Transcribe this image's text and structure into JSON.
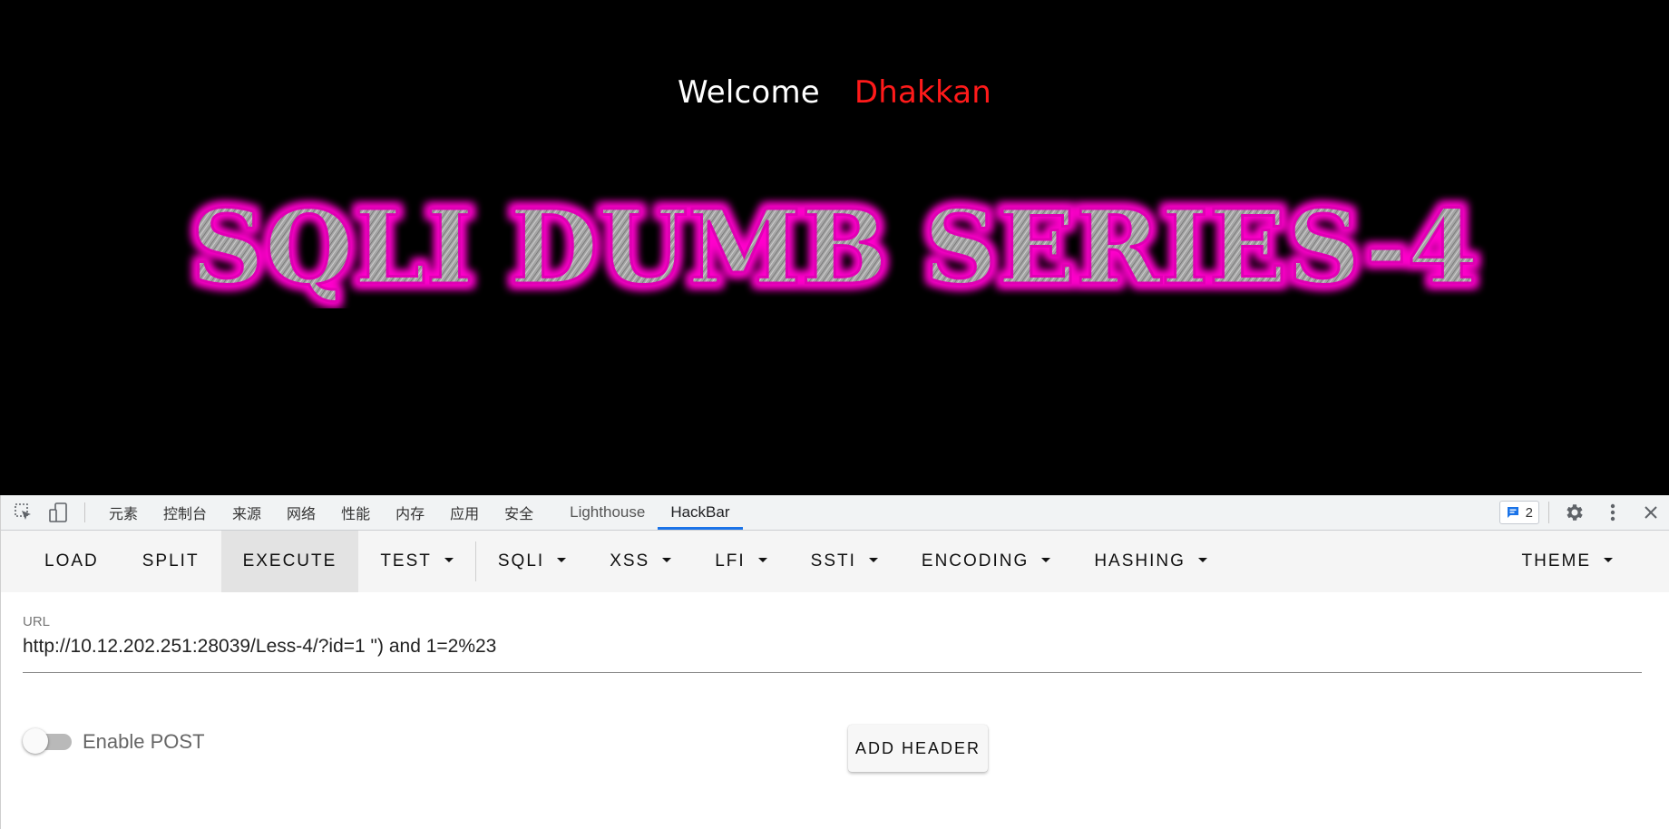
{
  "page": {
    "welcome_word": "Welcome",
    "welcome_name": "Dhakkan",
    "banner_text": "SQLI DUMB SERIES-4",
    "colors": {
      "background": "#000000",
      "welcome": "#ffffff",
      "name": "#ff1a1a",
      "banner_glow": "#ff00cc",
      "banner_fill": "#9a9a9a"
    }
  },
  "devtools": {
    "inspect_icon": "cursor-select-icon",
    "device_icon": "device-toggle-icon",
    "tabs": [
      {
        "label": "元素"
      },
      {
        "label": "控制台"
      },
      {
        "label": "来源"
      },
      {
        "label": "网络"
      },
      {
        "label": "性能"
      },
      {
        "label": "内存"
      },
      {
        "label": "应用"
      },
      {
        "label": "安全"
      },
      {
        "label": "Lighthouse"
      },
      {
        "label": "HackBar"
      }
    ],
    "active_tab": "HackBar",
    "issues_count": "2",
    "accent_color": "#1a73e8"
  },
  "hackbar": {
    "toolbar": {
      "load": "LOAD",
      "split": "SPLIT",
      "execute": "EXECUTE",
      "test": "TEST",
      "sqli": "SQLI",
      "xss": "XSS",
      "lfi": "LFI",
      "ssti": "SSTI",
      "encoding": "ENCODING",
      "hashing": "HASHING",
      "theme": "THEME"
    },
    "url_label": "URL",
    "url_value": "http://10.12.202.251:28039/Less-4/?id=1 \") and 1=2%23",
    "enable_post_label": "Enable POST",
    "enable_post_on": false,
    "add_header_label": "ADD HEADER"
  }
}
